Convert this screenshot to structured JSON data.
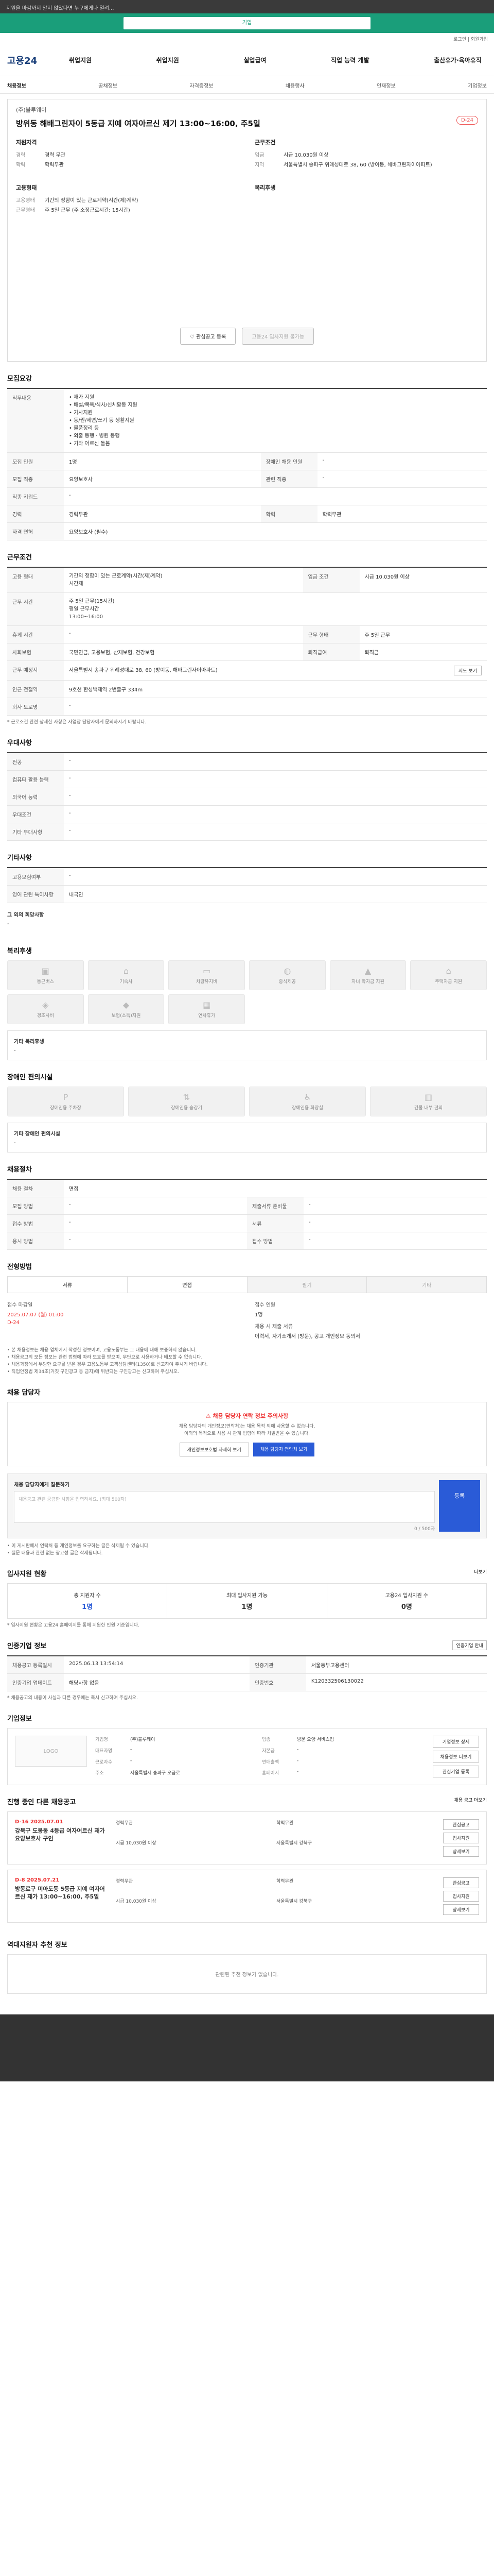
{
  "topbar": {
    "text": "지원을 마감까지 알지 않았다면 누구에게나 열려..."
  },
  "hero": {
    "label": "기업"
  },
  "mini": {
    "text": "로그인 | 회원가입"
  },
  "header": {
    "logo": "고용24",
    "nav": [
      "취업지원",
      "취업지원",
      "실업급여",
      "직업 능력 개발",
      "출산휴가·육아휴직"
    ]
  },
  "lnb": [
    "채용정보",
    "공채정보",
    "자격증정보",
    "채용행사",
    "인재정보",
    "기업정보"
  ],
  "job": {
    "company": "(주)블루웨이",
    "title": "방위동 해배그린자이 5동급 지예 여자아르신 제기 13:00~16:00, 주5일",
    "dday": "D-24",
    "recruit_head": "지원자격",
    "recruit": [
      {
        "k": "경력",
        "v": "경력 무관"
      },
      {
        "k": "학력",
        "v": "학력무관"
      }
    ],
    "work_head": "근무조건",
    "work": [
      {
        "k": "임금",
        "v": "시급 10,030원 이상"
      },
      {
        "k": "지역",
        "v": "서울특별시 송파구 위례성대로 38, 60 (방이동, 해바그린자이아파트)"
      }
    ],
    "type_head": "고용형태",
    "type": [
      {
        "k": "고용형태",
        "v": "기간의 정함이 있는 근로계약(시간(제)계약)"
      },
      {
        "k": "근무형태",
        "v": "주 5일 근무 (주 소정근로시간: 15시간)"
      }
    ],
    "welfare_head": "복리후생",
    "btn_save": "관심공고 등록",
    "btn_apply": "고용24 입사지원 불가능"
  },
  "recruit_section": {
    "title": "모집요강",
    "duty_label": "직무내용",
    "duty": "• 재가 지원\n• 배설/목욕/식사/신체활동 지원\n• 가사지원\n• 등/권/세면/쏘기 등 생활지원\n• 물품정리 등\n• 외출 동행 · 병원 동행\n• 기타 어르신 돌봄",
    "rows": [
      [
        {
          "k": "모집 인원",
          "v": "1명"
        },
        {
          "k": "장애인 채용 인원",
          "v": "-"
        }
      ],
      [
        {
          "k": "모집 직종",
          "v": "요양보호사"
        },
        {
          "k": "관련 직종",
          "v": "-"
        }
      ],
      [
        {
          "k": "직종 키워드",
          "v": "-"
        }
      ],
      [
        {
          "k": "경력",
          "v": "경력무관"
        },
        {
          "k": "학력",
          "v": "학력무관"
        }
      ],
      [
        {
          "k": "자격 면허",
          "v": "요양보호사 (필수)"
        }
      ]
    ]
  },
  "work_section": {
    "title": "근무조건",
    "contract": "기간의 정함이 있는 근로계약(시간(제)계약)\n시간제",
    "wage": "시급 10,030원 이상",
    "hours_label": "근무 시간",
    "hours": "주 5일 근무(15시간)",
    "time": "평일 근무시간\n13:00~16:00",
    "rows": [
      [
        {
          "k": "휴게 시간",
          "v": "-"
        },
        {
          "k": "근무 형태",
          "v": "주 5일 근무"
        }
      ],
      [
        {
          "k": "사회보험",
          "v": "국민연금, 고용보험, 산재보험, 건강보험"
        },
        {
          "k": "퇴직급여",
          "v": "퇴직금"
        }
      ],
      [
        {
          "k": "근무 예정지",
          "v": "서울특별시 송파구 위례성대로 38, 60 (방이동, 해바그린자이아파트)"
        }
      ],
      [
        {
          "k": "인근 전철역",
          "v": "9호선 한성백제역 2번출구 334m"
        }
      ],
      [
        {
          "k": "회사 도로명",
          "v": "-"
        }
      ]
    ],
    "map_btn": "지도 보기",
    "note": "* 근로조건 관련 상세한 사항은 사업장 담당자에게 문의하시기 바랍니다."
  },
  "pref_section": {
    "title": "우대사항",
    "rows": [
      {
        "k": "전공",
        "v": "-"
      },
      {
        "k": "컴퓨터 활용 능력",
        "v": "-"
      },
      {
        "k": "외국어 능력",
        "v": "-"
      },
      {
        "k": "우대조건",
        "v": "-"
      },
      {
        "k": "기타 우대사항",
        "v": "-"
      }
    ]
  },
  "etc_section": {
    "title": "기타사항",
    "rows": [
      {
        "k": "고용보험여부",
        "v": "-"
      },
      {
        "k": "영어 관련 특이사항",
        "v": "내국인"
      }
    ],
    "extra_label": "그 외의 희망사항",
    "extra": "-"
  },
  "welfare_section": {
    "title": "복리후생",
    "items": [
      "통근버스",
      "기숙사",
      "차량유지비",
      "중식제공",
      "자녀 학자금 지원",
      "주택자금 지원",
      "경조사비",
      "보험(소득)지원",
      "연차휴가"
    ],
    "etc_label": "기타 복리후생",
    "etc": "-"
  },
  "access_section": {
    "title": "장애인 편의시설",
    "items": [
      "장애인용 주차장",
      "장애인용 승강기",
      "장애인용 화장실",
      "건물 내부 편의"
    ],
    "etc_label": "기타 장애인 편의시설",
    "etc": "-"
  },
  "selection_section": {
    "title": "채용절차",
    "rows": [
      [
        {
          "k": "채용 절차",
          "v": "면접"
        }
      ],
      [
        {
          "k": "모집 방법",
          "v": "-"
        },
        {
          "k": "제출서류 준비물",
          "v": "-"
        }
      ],
      [
        {
          "k": "접수 방법",
          "v": "-"
        },
        {
          "k": "서류",
          "v": "-"
        }
      ],
      [
        {
          "k": "응시 방법",
          "v": "-"
        },
        {
          "k": "접수 방법",
          "v": "-"
        }
      ]
    ]
  },
  "apply_section": {
    "title": "전형방법",
    "tabs": [
      "서류",
      "면접",
      "필기",
      "기타"
    ],
    "deadline_label": "접수 마감일",
    "deadline": "2025.07.07 (월) 01:00",
    "dday": "D-24",
    "count_label": "접수 인원",
    "count": "1명",
    "method_label": "채용 시 제출 서류",
    "method": "이력서, 자기소개서 (방문), 공고 개인정보 동의서",
    "notes": [
      "• 본 채용정보는 채용 업체에서 작성한 정보이며, 고용노동부는 그 내용에 대해 보증하지 않습니다.",
      "• 채용공고의 모든 정보는 관련 법령에 따라 보호를 받으며, 무단으로 사용하거나 배포할 수 없습니다.",
      "• 채용과정에서 부당한 요구를 받은 경우 고용노동부 고객상담센터(1350)로 신고하여 주시기 바랍니다.",
      "• 직업안정법 제34조(거짓 구인광고 등 금지)에 위반되는 구인광고는 신고하여 주십시오."
    ]
  },
  "qa_section": {
    "title": "채용 담당자",
    "alert": "채용 담당자 연락 정보 주의사항",
    "desc": "채용 담당자의 개인정보(연락처)는 채용 목적 외에 사용할 수 없습니다.\n이외의 목적으로 사용 시 관계 법령에 따라 처벌받을 수 있습니다.",
    "btn1": "개인정보보호법 자세히 보기",
    "btn2": "채용 담당자 연락처 보기",
    "q_label": "채용 담당자에게 질문하기",
    "q_placeholder": "채용공고 관련 궁금한 사항을 입력하세요. (최대 500자)",
    "q_send": "등록",
    "q_count": "0 / 500자",
    "notes": [
      "• 이 게시판에서 연락처 등 개인정보를 요구하는 글은 삭제될 수 있습니다.",
      "• 질문 내용과 관련 없는 광고성 글은 삭제됩니다."
    ]
  },
  "status_section": {
    "title": "입사지원 현황",
    "more": "더보기",
    "cells": [
      {
        "label": "총 지원자 수",
        "value": "1명"
      },
      {
        "label": "최대 입사지원 가능",
        "value": "1명"
      },
      {
        "label": "고용24 입사지원 수",
        "value": "0명"
      }
    ],
    "note": "* 입사지원 현황은 고용24 홈페이지를 통해 지원한 인원 기준입니다."
  },
  "source_section": {
    "title": "인증기업 정보",
    "btn": "인증기업 안내",
    "rows": [
      [
        {
          "k": "채용공고 등록일시",
          "v": "2025.06.13 13:54:14"
        },
        {
          "k": "인증기관",
          "v": "서울동부고용센터"
        }
      ],
      [
        {
          "k": "인증기업 업데이트",
          "v": "해당사항 없음"
        },
        {
          "k": "인증번호",
          "v": "K120332506130022"
        }
      ]
    ],
    "note": "* 채용공고의 내용이 사실과 다른 경우에는 즉시 신고하여 주십시오."
  },
  "company_section": {
    "title": "기업정보",
    "logo_text": "LOGO",
    "fields": [
      {
        "k": "기업명",
        "v": "(주)블루웨이"
      },
      {
        "k": "업종",
        "v": "방문 요양 서비스업"
      },
      {
        "k": "대표자명",
        "v": "-"
      },
      {
        "k": "자본금",
        "v": "-"
      },
      {
        "k": "근로자수",
        "v": "-"
      },
      {
        "k": "연매출액",
        "v": "-"
      },
      {
        "k": "주소",
        "v": "서울특별시 송파구 오금로"
      },
      {
        "k": "홈페이지",
        "v": "-"
      }
    ],
    "btns": [
      "기업정보 상세",
      "채용정보 더보기",
      "관심기업 등록"
    ]
  },
  "similar_section": {
    "title": "진행 중인 다른 채용공고",
    "more": "채용 공고 더보기",
    "items": [
      {
        "dd": "D-16  2025.07.01",
        "title": "강북구 도봉동 4등급 여자어르신 재가 요양보호사 구인",
        "meta": [
          "경력무관",
          "학력무관",
          "시급 10,030원 이상",
          "서울특별시 강북구"
        ]
      },
      {
        "dd": "D-8  2025.07.21",
        "title": "방동로구 미아도동 5등급 지예 여자어르신 재가 13:00~16:00, 주5일",
        "meta": [
          "경력무관",
          "학력무관",
          "시급 10,030원 이상",
          "서울특별시 강북구"
        ]
      }
    ],
    "btns": [
      "관심공고",
      "입사지원",
      "상세보기"
    ]
  },
  "final_section": {
    "title": "역대지원자 추천 정보",
    "empty": "관련된 추천 정보가 없습니다."
  }
}
